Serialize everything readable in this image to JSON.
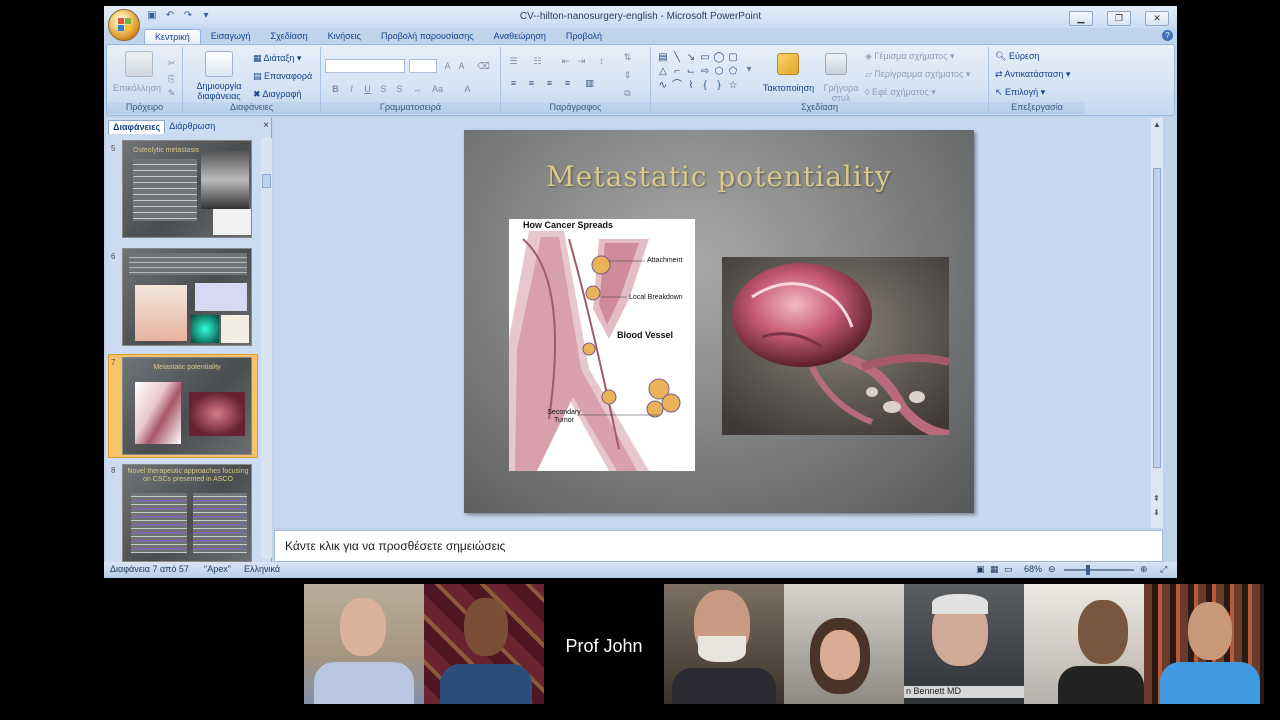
{
  "window": {
    "title": "CV--hilton-nanosurgery-english - Microsoft PowerPoint"
  },
  "tabs": [
    "Κεντρική",
    "Εισαγωγή",
    "Σχεδίαση",
    "Κινήσεις",
    "Προβολή παρουσίασης",
    "Αναθεώρηση",
    "Προβολή"
  ],
  "ribbon": {
    "clipboard": {
      "label": "Πρόχειρο",
      "paste": "Επικόλληση"
    },
    "slides": {
      "label": "Διαφάνειες",
      "new_slide": "Δημιουργία διαφάνειας",
      "layout": "Διάταξη",
      "reset": "Επαναφορά",
      "delete": "Διαγραφή"
    },
    "font": {
      "label": "Γραμματοσειρά"
    },
    "paragraph": {
      "label": "Παράγραφος"
    },
    "drawing": {
      "label": "Σχεδίαση",
      "arrange": "Τακτοποίηση",
      "quick_styles": "Γρήγορα στυλ",
      "fill": "Γέμισμα σχήματος",
      "outline": "Περίγραμμα σχήματος",
      "effects": "Εφέ σχήματος"
    },
    "editing": {
      "label": "Επεξεργασία",
      "find": "Εύρεση",
      "replace": "Αντικατάσταση",
      "select": "Επιλογή"
    }
  },
  "panel": {
    "tab_slides": "Διαφάνειες",
    "tab_outline": "Διάρθρωση",
    "close": "×",
    "thumbs": [
      {
        "num": "5",
        "title": "Osteolytic metastasis"
      },
      {
        "num": "6",
        "title": ""
      },
      {
        "num": "7",
        "title": "Metastatic potentiality"
      },
      {
        "num": "8",
        "title": "Novel therapeutic approaches focusing on CSCs presented in ASCO"
      }
    ]
  },
  "slide": {
    "title": "Metastatic potentiality",
    "figure": {
      "heading": "How Cancer Spreads",
      "attachment": "Attachment",
      "local_breakdown": "Local Breakdown",
      "blood_vessel": "Blood Vessel",
      "secondary_tumor": "Secondary Tumor"
    }
  },
  "notes": {
    "placeholder": "Κάντε κλικ για να προσθέσετε σημειώσεις"
  },
  "status": {
    "slide_info": "Διαφάνεια 7 από 57",
    "theme": "\"Apex\"",
    "language": "Ελληνικά",
    "zoom": "68%"
  },
  "participants": [
    {
      "name": ""
    },
    {
      "name": ""
    },
    {
      "name": "Prof John"
    },
    {
      "name": ""
    },
    {
      "name": ""
    },
    {
      "name": "n Bennett MD"
    },
    {
      "name": ""
    },
    {
      "name": ""
    }
  ]
}
